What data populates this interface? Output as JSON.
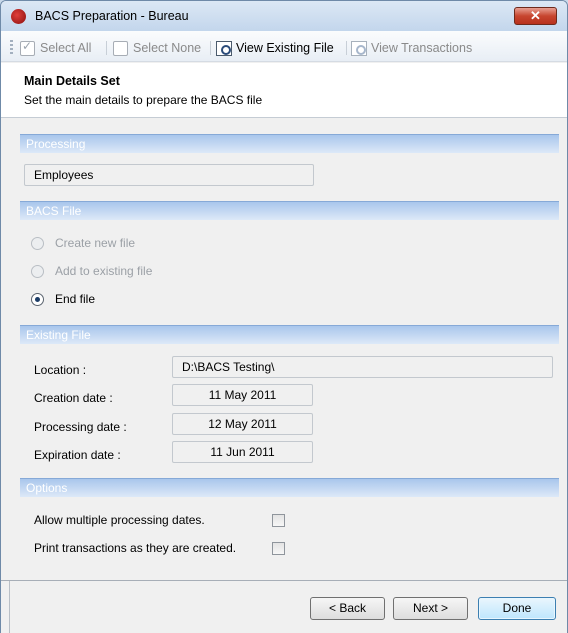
{
  "window": {
    "title": "BACS Preparation - Bureau",
    "close_glyph": "✕"
  },
  "toolbar": {
    "select_all": "Select All",
    "select_none": "Select None",
    "view_existing_file": "View Existing File",
    "view_transactions": "View Transactions"
  },
  "header": {
    "title": "Main Details Set",
    "subtitle": "Set the main details to prepare the BACS file"
  },
  "processing": {
    "section_label": "Processing",
    "value": "Employees"
  },
  "bacs_file": {
    "section_label": "BACS File",
    "options": [
      {
        "label": "Create new file",
        "selected": false,
        "enabled": false
      },
      {
        "label": "Add to existing file",
        "selected": false,
        "enabled": false
      },
      {
        "label": "End file",
        "selected": true,
        "enabled": true
      }
    ]
  },
  "existing_file": {
    "section_label": "Existing File",
    "location_label": "Location :",
    "location_value": "D:\\BACS Testing\\",
    "creation_label": "Creation date :",
    "creation_value": "11 May 2011",
    "processing_label": "Processing date :",
    "processing_value": "12 May 2011",
    "expiration_label": "Expiration date :",
    "expiration_value": "11 Jun 2011"
  },
  "options": {
    "section_label": "Options",
    "allow_multiple_label": "Allow multiple processing dates.",
    "allow_multiple_checked": false,
    "print_transactions_label": "Print transactions as they are created.",
    "print_transactions_checked": false
  },
  "footer": {
    "back": "< Back",
    "next": "Next >",
    "done": "Done"
  },
  "colors": {
    "section_header": "#a9c6ec",
    "close_button": "#c7452f",
    "default_button": "#bee6fd"
  }
}
